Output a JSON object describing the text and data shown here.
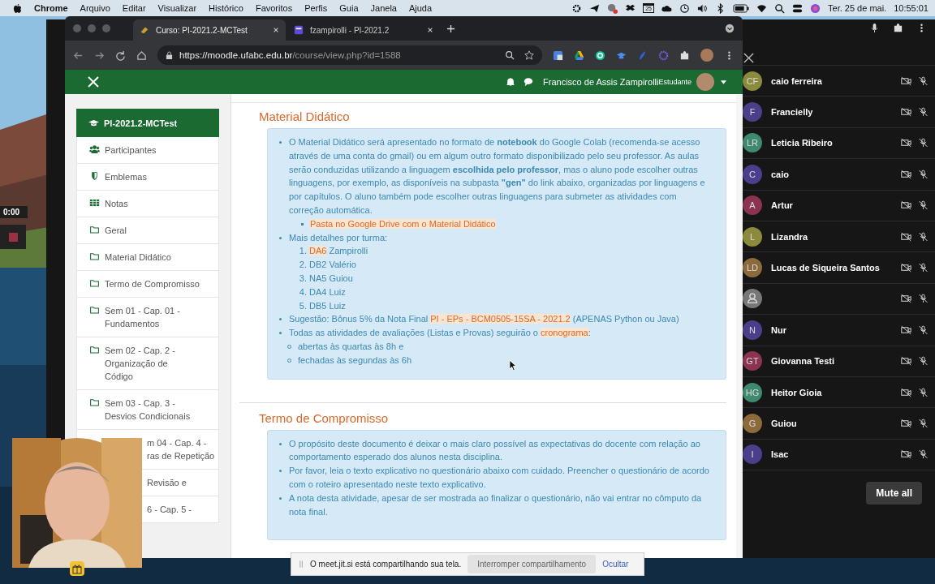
{
  "menubar": {
    "app": "Chrome",
    "menus": [
      "Arquivo",
      "Editar",
      "Visualizar",
      "Histórico",
      "Favoritos",
      "Perfis",
      "Guia",
      "Janela",
      "Ajuda"
    ],
    "calendar_day": "25",
    "date": "Ter. 25 de mai.",
    "time": "10:55:01"
  },
  "recorder": {
    "timer": "0:00"
  },
  "browser": {
    "tabs": [
      {
        "title": "Curso: PI-2021.2-MCTest",
        "selected": true
      },
      {
        "title": "fzampirolli - PI-2021.2",
        "selected": false
      }
    ],
    "url_host": "https://moodle.ufabc.edu.br",
    "url_path": "/course/view.php?id=1588"
  },
  "navbar": {
    "user": "Francisco de Assis Zampirolli",
    "role": "Estudante"
  },
  "sidebar": {
    "header": "PI-2021.2-MCTest",
    "items": [
      {
        "kind": "people",
        "lines": [
          "Participantes"
        ]
      },
      {
        "kind": "shield",
        "lines": [
          "Emblemas"
        ]
      },
      {
        "kind": "table",
        "lines": [
          "Notas"
        ]
      },
      {
        "kind": "folder",
        "lines": [
          "Geral"
        ]
      },
      {
        "kind": "folder",
        "lines": [
          "Material Didático"
        ]
      },
      {
        "kind": "folder",
        "lines": [
          "Termo de Compromisso"
        ]
      },
      {
        "kind": "folder",
        "lines": [
          "Sem 01 - Cap. 01 -",
          "Fundamentos"
        ]
      },
      {
        "kind": "folder",
        "lines": [
          "Sem 02 - Cap. 2 -",
          "Organização de",
          "Código"
        ]
      },
      {
        "kind": "folder",
        "lines": [
          "Sem 03 - Cap. 3 -",
          "Desvios Condicionais"
        ]
      },
      {
        "kind": "covered",
        "lines": [
          "m 04 - Cap. 4 -",
          "ras de Repetição"
        ]
      },
      {
        "kind": "covered",
        "lines": [
          "Revisão e"
        ]
      },
      {
        "kind": "covered",
        "lines": [
          "6 - Cap. 5 -"
        ]
      }
    ]
  },
  "sections": [
    {
      "title": "Material Didático",
      "items": [
        {
          "parts": [
            {
              "text": "O Material Didático será apresentado no formato de **notebook** do Google Colab (recomenda-se acesso através de uma conta do gmail) ou em algum outro formato disponibilizado pelo seu professor. As aulas serão conduzidas utilizando a linguagem **escolhida pelo professor**, mas o aluno pode escolher outras linguagens, por exemplo, as disponíveis na subpasta **\"gen\"** do link abaixo, organizadas por linguagens e por capítulos. O aluno também pode escolher outras linguagens para submeter as atividades com correção automática.",
              "link": false
            }
          ],
          "children": [
            {
              "kind": "square",
              "parts": [
                {
                  "text": "Pasta no Google Drive com o Material Didático",
                  "link": true
                }
              ]
            }
          ]
        },
        {
          "parts": [
            {
              "text": "Mais detalhes por turma:",
              "link": false
            }
          ],
          "children": [
            {
              "kind": "number",
              "number": "1.",
              "parts": [
                {
                  "text": "DA6",
                  "link": true
                },
                {
                  "text": " Zampirolli",
                  "link": false
                }
              ]
            },
            {
              "kind": "number",
              "number": "2.",
              "parts": [
                {
                  "text": "DB2 Valério",
                  "link": false
                }
              ]
            },
            {
              "kind": "number",
              "number": "3.",
              "parts": [
                {
                  "text": "NA5 Guiou",
                  "link": false
                }
              ]
            },
            {
              "kind": "number",
              "number": "4.",
              "parts": [
                {
                  "text": "DA4 Luiz",
                  "link": false
                }
              ]
            },
            {
              "kind": "number",
              "number": "5.",
              "parts": [
                {
                  "text": "DB5 Luiz",
                  "link": false
                }
              ]
            }
          ]
        },
        {
          "parts": [
            {
              "text": "Sugestão: Bônus 5% da Nota Final ",
              "link": false
            },
            {
              "text": "PI - EPs - BCM0505-15SA - 2021.2",
              "link": true
            },
            {
              "text": " (APENAS Python ou Java)",
              "link": false
            }
          ]
        },
        {
          "parts": [
            {
              "text": "Todas as atividades de avaliações (Listas e Provas) seguirão o ",
              "link": false
            },
            {
              "text": "cronograma",
              "link": true
            },
            {
              "text": ":",
              "link": false
            }
          ]
        },
        {
          "kind": "circle",
          "parts": [
            {
              "text": "abertas às quartas às 8h e",
              "link": false
            }
          ]
        },
        {
          "kind": "circle",
          "parts": [
            {
              "text": "fechadas às segundas às 6h",
              "link": false
            }
          ]
        }
      ]
    },
    {
      "title": "Termo de Compromisso",
      "items": [
        {
          "parts": [
            {
              "text": "O propósito deste documento é deixar o mais claro possível as expectativas do docente com relação ao comportamento esperado dos alunos nesta disciplina.",
              "link": false
            }
          ]
        },
        {
          "parts": [
            {
              "text": "Por favor, leia o texto explicativo no questionário abaixo com cuidado. Preencher o questionário de acordo com o roteiro apresentado neste texto explicativo.",
              "link": false
            }
          ]
        },
        {
          "parts": [
            {
              "text": "A nota desta atividade, apesar de ser mostrada ao finalizar o questionário, não vai entrar no cômputo da nota final.",
              "link": false
            }
          ]
        }
      ]
    }
  ],
  "participants": [
    {
      "kind": "initials",
      "initials": "CF",
      "name": "caio ferreira",
      "color": "#8c8a3c"
    },
    {
      "kind": "initials",
      "initials": "F",
      "name": "Francielly",
      "color": "#4b3f8c"
    },
    {
      "kind": "initials",
      "initials": "LR",
      "name": "Leticia Ribeiro",
      "color": "#3f8a6e"
    },
    {
      "kind": "initials",
      "initials": "C",
      "name": "caio",
      "color": "#4b3f8c"
    },
    {
      "kind": "initials",
      "initials": "A",
      "name": "Artur",
      "color": "#8c3350"
    },
    {
      "kind": "initials",
      "initials": "L",
      "name": "Lizandra",
      "color": "#8c8a3c"
    },
    {
      "kind": "initials",
      "initials": "LD",
      "name": "Lucas de Siqueira Santos",
      "color": "#8c6a3c"
    },
    {
      "kind": "anonymous",
      "color": "#777777"
    },
    {
      "kind": "initials",
      "initials": "N",
      "name": "Nur",
      "color": "#4b3f8c"
    },
    {
      "kind": "initials",
      "initials": "GT",
      "name": "Giovanna Testi",
      "color": "#8c3350"
    },
    {
      "kind": "initials",
      "initials": "HG",
      "name": "Heitor Gioia",
      "color": "#3f8a6e"
    },
    {
      "kind": "initials",
      "initials": "G",
      "name": "Guiou",
      "color": "#8c6a3c"
    },
    {
      "kind": "initials",
      "initials": "I",
      "name": "Isac",
      "color": "#4b3f8c"
    }
  ],
  "mute_all": "Mute all",
  "share_bar": {
    "message": "O meet.jit.si está compartilhando sua tela.",
    "stop": "Interromper compartilhamento",
    "hide": "Ocultar"
  }
}
